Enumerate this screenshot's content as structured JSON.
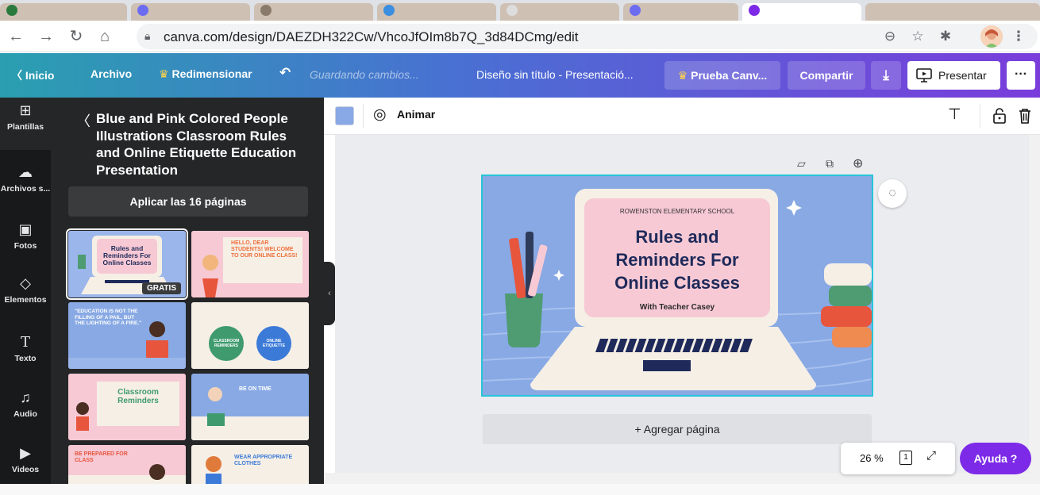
{
  "browser": {
    "url": "canva.com/design/DAEZDH322Cw/VhcoJfOIm8b7Q_3d84DCmg/edit"
  },
  "topbar": {
    "home": "Inicio",
    "file": "Archivo",
    "resize": "Redimensionar",
    "saving": "Guardando cambios...",
    "doc_title": "Diseño sin título - Presentació...",
    "trial": "Prueba Canv...",
    "share": "Compartir",
    "present": "Presentar",
    "more": "···"
  },
  "rail": {
    "items": [
      {
        "label": "Plantillas",
        "icon": "templates-icon"
      },
      {
        "label": "Archivos s...",
        "icon": "upload-cloud-icon"
      },
      {
        "label": "Fotos",
        "icon": "photo-icon"
      },
      {
        "label": "Elementos",
        "icon": "shapes-icon"
      },
      {
        "label": "Texto",
        "icon": "text-icon"
      },
      {
        "label": "Audio",
        "icon": "music-note-icon"
      },
      {
        "label": "Videos",
        "icon": "video-icon"
      }
    ]
  },
  "panel": {
    "title": "Blue and Pink Colored People Illustrations Classroom Rules and Online Etiquette Education Presentation",
    "apply": "Aplicar las 16 páginas",
    "badge": "GRATIS",
    "thumbs": {
      "t1_title": "Rules and Reminders For Online Classes",
      "t2_title": "HELLO, DEAR STUDENTS! WELCOME TO OUR ONLINE CLASS!",
      "t3_title": "\"EDUCATION IS NOT THE FILLING OF A PAIL, BUT THE LIGHTING OF A FIRE.\"",
      "t4_a": "CLASSROOM REMINDERS",
      "t4_b": "ONLINE ETIQUETTE",
      "t5_title": "Classroom Reminders",
      "t6_title": "BE ON TIME",
      "t7_title": "BE PREPARED FOR CLASS",
      "t8_title": "WEAR APPROPRIATE CLOTHES"
    }
  },
  "toolbar": {
    "animate": "Animar",
    "swatch_color": "#89a9e6"
  },
  "slide": {
    "school": "ROWENSTON ELEMENTARY SCHOOL",
    "title_line1": "Rules and",
    "title_line2": "Reminders For",
    "title_line3": "Online Classes",
    "subtitle": "With Teacher Casey"
  },
  "canvas": {
    "add_page": "+ Agregar página",
    "zoom": "26 %",
    "page_number": "1",
    "help": "Ayuda ?"
  },
  "colors": {
    "canva_purple": "#7d2ae8",
    "slide_bg": "#88a9e4",
    "slide_pink": "#f7c9d4",
    "slide_navy": "#1f2a5a"
  }
}
